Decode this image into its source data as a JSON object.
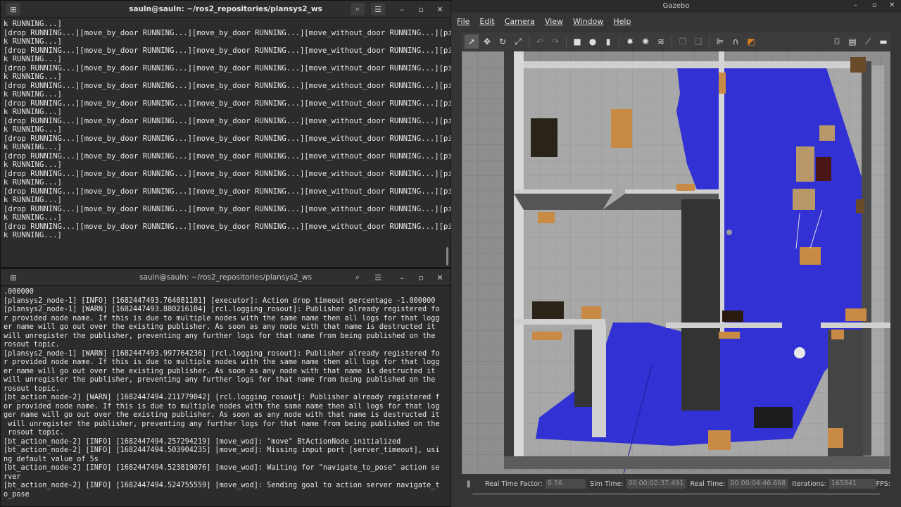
{
  "terminal_top": {
    "title": "sauln@sauln: ~/ros2_repositories/plansys2_ws",
    "lines": [
      "k RUNNING...]",
      "[drop RUNNING...][move_by_door RUNNING...][move_by_door RUNNING...][move_without_door RUNNING...][pic",
      "k RUNNING...]",
      "[drop RUNNING...][move_by_door RUNNING...][move_by_door RUNNING...][move_without_door RUNNING...][pic",
      "k RUNNING...]",
      "[drop RUNNING...][move_by_door RUNNING...][move_by_door RUNNING...][move_without_door RUNNING...][pic",
      "k RUNNING...]",
      "[drop RUNNING...][move_by_door RUNNING...][move_by_door RUNNING...][move_without_door RUNNING...][pic",
      "k RUNNING...]",
      "[drop RUNNING...][move_by_door RUNNING...][move_by_door RUNNING...][move_without_door RUNNING...][pic",
      "k RUNNING...]",
      "[drop RUNNING...][move_by_door RUNNING...][move_by_door RUNNING...][move_without_door RUNNING...][pic",
      "k RUNNING...]",
      "[drop RUNNING...][move_by_door RUNNING...][move_by_door RUNNING...][move_without_door RUNNING...][pic",
      "k RUNNING...]",
      "[drop RUNNING...][move_by_door RUNNING...][move_by_door RUNNING...][move_without_door RUNNING...][pic",
      "k RUNNING...]",
      "[drop RUNNING...][move_by_door RUNNING...][move_by_door RUNNING...][move_without_door RUNNING...][pic",
      "k RUNNING...]",
      "[drop RUNNING...][move_by_door RUNNING...][move_by_door RUNNING...][move_without_door RUNNING...][pic",
      "k RUNNING...]",
      "[drop RUNNING...][move_by_door RUNNING...][move_by_door RUNNING...][move_without_door RUNNING...][pic",
      "k RUNNING...]",
      "[drop RUNNING...][move_by_door RUNNING...][move_by_door RUNNING...][move_without_door RUNNING...][pic",
      "k RUNNING...]"
    ]
  },
  "terminal_bottom": {
    "title": "sauln@sauln: ~/ros2_repositories/plansys2_ws",
    "lines": [
      ".000000",
      "[plansys2_node-1] [INFO] [1682447493.764081101] [executor]: Action drop timeout percentage -1.000000",
      "[plansys2_node-1] [WARN] [1682447493.880216104] [rcl.logging_rosout]: Publisher already registered fo",
      "r provided node name. If this is due to multiple nodes with the same name then all logs for that logg",
      "er name will go out over the existing publisher. As soon as any node with that name is destructed it",
      "will unregister the publisher, preventing any further logs for that name from being published on the",
      "rosout topic.",
      "[plansys2_node-1] [WARN] [1682447493.997764236] [rcl.logging_rosout]: Publisher already registered fo",
      "r provided node name. If this is due to multiple nodes with the same name then all logs for that logg",
      "er name will go out over the existing publisher. As soon as any node with that name is destructed it",
      "will unregister the publisher, preventing any further logs for that name from being published on the",
      "rosout topic.",
      "[bt_action_node-2] [WARN] [1682447494.211779042] [rcl.logging_rosout]: Publisher already registered f",
      "or provided node name. If this is due to multiple nodes with the same name then all logs for that log",
      "ger name will go out over the existing publisher. As soon as any node with that name is destructed it",
      " will unregister the publisher, preventing any further logs for that name from being published on the",
      " rosout topic.",
      "[bt_action_node-2] [INFO] [1682447494.257294219] [move_wod]: \"move\" BtActionNode initialized",
      "[bt_action_node-2] [INFO] [1682447494.503904235] [move_wod]: Missing input port [server_timeout], usi",
      "ng default value of 5s",
      "[bt_action_node-2] [INFO] [1682447494.523819076] [move_wod]: Waiting for \"navigate_to_pose\" action se",
      "rver",
      "[bt_action_node-2] [INFO] [1682447494.524755559] [move_wod]: Sending goal to action server navigate_t",
      "o_pose"
    ]
  },
  "gazebo": {
    "title": "Gazebo",
    "menu": [
      "File",
      "Edit",
      "Camera",
      "View",
      "Window",
      "Help"
    ],
    "status": {
      "rtf_label": "Real Time Factor:",
      "rtf_value": "0.56",
      "sim_label": "Sim Time:",
      "sim_value": "00 00:02:37.491",
      "real_label": "Real Time:",
      "real_value": "00 00:04:46.668",
      "iter_label": "Iterations:",
      "iter_value": "165841",
      "fps_label": "FPS:"
    },
    "colors": {
      "laser": "#2b2bd6",
      "floor": "#8c8c8c",
      "wall": "#6a6a6a",
      "furniture": "#c98a45"
    }
  }
}
